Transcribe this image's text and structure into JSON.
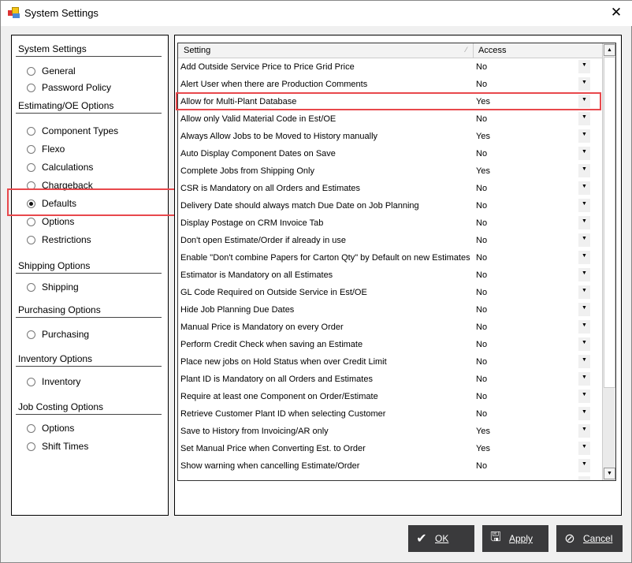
{
  "window": {
    "title": "System Settings",
    "close_label": "✕"
  },
  "sidebar": {
    "sections": [
      {
        "title": "System Settings",
        "items": [
          "General",
          "Password Policy"
        ]
      },
      {
        "title": "Estimating/OE Options",
        "items": [
          "Component Types",
          "Flexo",
          "Calculations",
          "Chargeback",
          "Defaults",
          "Options",
          "Restrictions"
        ]
      },
      {
        "title": "Shipping Options",
        "items": [
          "Shipping"
        ]
      },
      {
        "title": "Purchasing Options",
        "items": [
          "Purchasing"
        ]
      },
      {
        "title": "Inventory Options",
        "items": [
          "Inventory"
        ]
      },
      {
        "title": "Job Costing Options",
        "items": [
          "Options",
          "Shift Times"
        ]
      }
    ],
    "selected": "Defaults"
  },
  "grid": {
    "columns": {
      "setting": "Setting",
      "access": "Access"
    },
    "rows": [
      {
        "setting": "Add Outside Service Price to Price Grid Price",
        "access": "No"
      },
      {
        "setting": "Alert User when there are Production Comments",
        "access": "No"
      },
      {
        "setting": "Allow for Multi-Plant Database",
        "access": "Yes"
      },
      {
        "setting": "Allow only Valid Material Code in Est/OE",
        "access": "No"
      },
      {
        "setting": "Always Allow Jobs to be Moved to History manually",
        "access": "Yes"
      },
      {
        "setting": "Auto Display Component Dates on Save",
        "access": "No"
      },
      {
        "setting": "Complete Jobs from Shipping Only",
        "access": "Yes"
      },
      {
        "setting": "CSR is Mandatory on all Orders and Estimates",
        "access": "No"
      },
      {
        "setting": "Delivery Date should always match Due Date on Job Planning",
        "access": "No"
      },
      {
        "setting": "Display Postage on CRM Invoice Tab",
        "access": "No"
      },
      {
        "setting": "Don't open Estimate/Order if already in use",
        "access": "No"
      },
      {
        "setting": "Enable \"Don't combine Papers for Carton Qty\" by Default on new Estimates",
        "access": "No"
      },
      {
        "setting": "Estimator is Mandatory on all Estimates",
        "access": "No"
      },
      {
        "setting": "GL Code Required on Outside Service in Est/OE",
        "access": "No"
      },
      {
        "setting": "Hide Job Planning Due Dates",
        "access": "No"
      },
      {
        "setting": "Manual Price is Mandatory on every Order",
        "access": "No"
      },
      {
        "setting": "Perform Credit Check when saving an Estimate",
        "access": "No"
      },
      {
        "setting": "Place new jobs on Hold Status when over Credit Limit",
        "access": "No"
      },
      {
        "setting": "Plant ID is Mandatory on all Orders and Estimates",
        "access": "No"
      },
      {
        "setting": "Require at least one Component on Order/Estimate",
        "access": "No"
      },
      {
        "setting": "Retrieve Customer Plant ID when selecting Customer",
        "access": "No"
      },
      {
        "setting": "Save to History from Invoicing/AR only",
        "access": "Yes"
      },
      {
        "setting": "Set Manual Price when Converting Est. to Order",
        "access": "Yes"
      },
      {
        "setting": "Show warning when cancelling Estimate/Order",
        "access": "No"
      }
    ],
    "highlighted_row": "Allow for Multi-Plant Database"
  },
  "buttons": {
    "ok": "OK",
    "apply": "Apply",
    "cancel": "Cancel"
  },
  "colors": {
    "highlight": "#e8484c",
    "button_bg": "#3a3a3c"
  }
}
